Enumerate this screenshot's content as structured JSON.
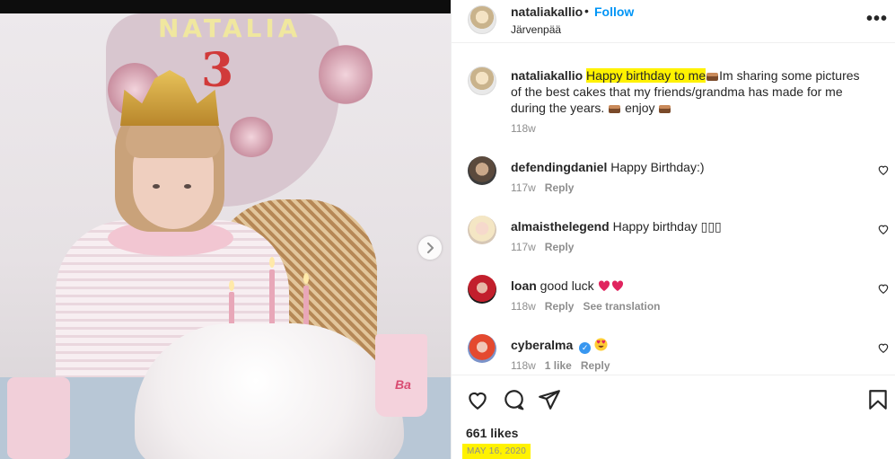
{
  "post": {
    "photo_alt_text": "NATALIA",
    "photo_number": "3",
    "cup_label": "Ba"
  },
  "header": {
    "username": "nataliakallio",
    "separator": "•",
    "follow_label": "Follow",
    "location": "Järvenpää",
    "more_label": "•••"
  },
  "caption": {
    "username": "nataliakallio",
    "highlight": "Happy birthday to me",
    "text_line1_rest": "Im sharing some pictures",
    "text_line2": "of the best cakes that my friends/grandma has made for me",
    "text_line3_start": "during the years.",
    "text_line3_mid": "enjoy",
    "time": "118w"
  },
  "comments": [
    {
      "username": "defendingdaniel",
      "text": "Happy Birthday:)",
      "time": "117w",
      "reply": "Reply"
    },
    {
      "username": "almaisthelegend",
      "text": "Happy birthday ▯▯▯",
      "time": "117w",
      "reply": "Reply"
    },
    {
      "username": "loan",
      "text": "good luck",
      "time": "118w",
      "reply": "Reply",
      "translation": "See translation"
    },
    {
      "username": "cyberalma",
      "text": "",
      "time": "118w",
      "likes": "1 like",
      "reply": "Reply",
      "verified": true
    }
  ],
  "footer": {
    "likes": "661 likes",
    "date": "MAY 16, 2020"
  },
  "colors": {
    "accent_blue": "#0095f6",
    "highlight_yellow": "#fff200",
    "muted_text": "#8e8e8e"
  },
  "icons": [
    "chevron-right-icon",
    "heart-icon",
    "comment-icon",
    "share-icon",
    "bookmark-icon",
    "more-icon",
    "verified-icon",
    "cake-emoji",
    "heart-emoji",
    "heart-eyes-emoji"
  ]
}
